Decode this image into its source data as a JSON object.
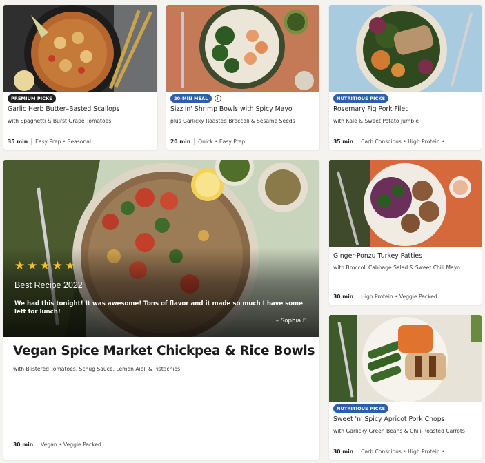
{
  "cards": [
    {
      "badge": "PREMIUM PICKS",
      "title": "Garlic Herb Butter–Basted Scallops",
      "subtitle": "with Spaghetti & Burst Grape Tomatoes",
      "time": "35 min",
      "tags": "Easy Prep • Seasonal"
    },
    {
      "badge": "20-MIN MEAL",
      "info_icon": "info-icon",
      "title": "Sizzlin' Shrimp Bowls with Spicy Mayo",
      "subtitle": "plus Garlicky Roasted Broccoli & Sesame Seeds",
      "time": "20 min",
      "tags": "Quick • Easy Prep"
    },
    {
      "badge": "NUTRITIOUS PICKS",
      "title": "Rosemary Fig Pork Filet",
      "subtitle": "with Kale & Sweet Potato Jumble",
      "time": "35 min",
      "tags": "Carb Conscious • High Protein • ..."
    },
    {
      "title": "Ginger-Ponzu Turkey Patties",
      "subtitle": "with Broccoli Cabbage Salad & Sweet Chili Mayo",
      "time": "30 min",
      "tags": "High Protein • Veggie Packed"
    },
    {
      "badge": "NUTRITIOUS PICKS",
      "title": "Sweet 'n' Spicy Apricot Pork Chops",
      "subtitle": "with Garlicky Green Beans & Chili-Roasted Carrots",
      "time": "30 min",
      "tags": "Carb Conscious • High Protein • ..."
    }
  ],
  "feature": {
    "rating_stars": 5,
    "award": "Best Recipe 2022",
    "quote": "We had this tonight! It was awesome! Tons of flavor and it made so much I have some left for lunch!",
    "author": "– Sophia E.",
    "title": "Vegan Spice Market Chickpea & Rice Bowls",
    "subtitle": "with Blistered Tomatoes, Schug Sauce, Lemon Aioli & Pistachios",
    "time": "30 min",
    "tags": "Vegan • Veggie Packed"
  },
  "colors": {
    "premium_badge": "#1f1f1f",
    "blue_badge": "#2d5dab",
    "star": "#f6c12c",
    "page_background": "#f4f3ef"
  }
}
